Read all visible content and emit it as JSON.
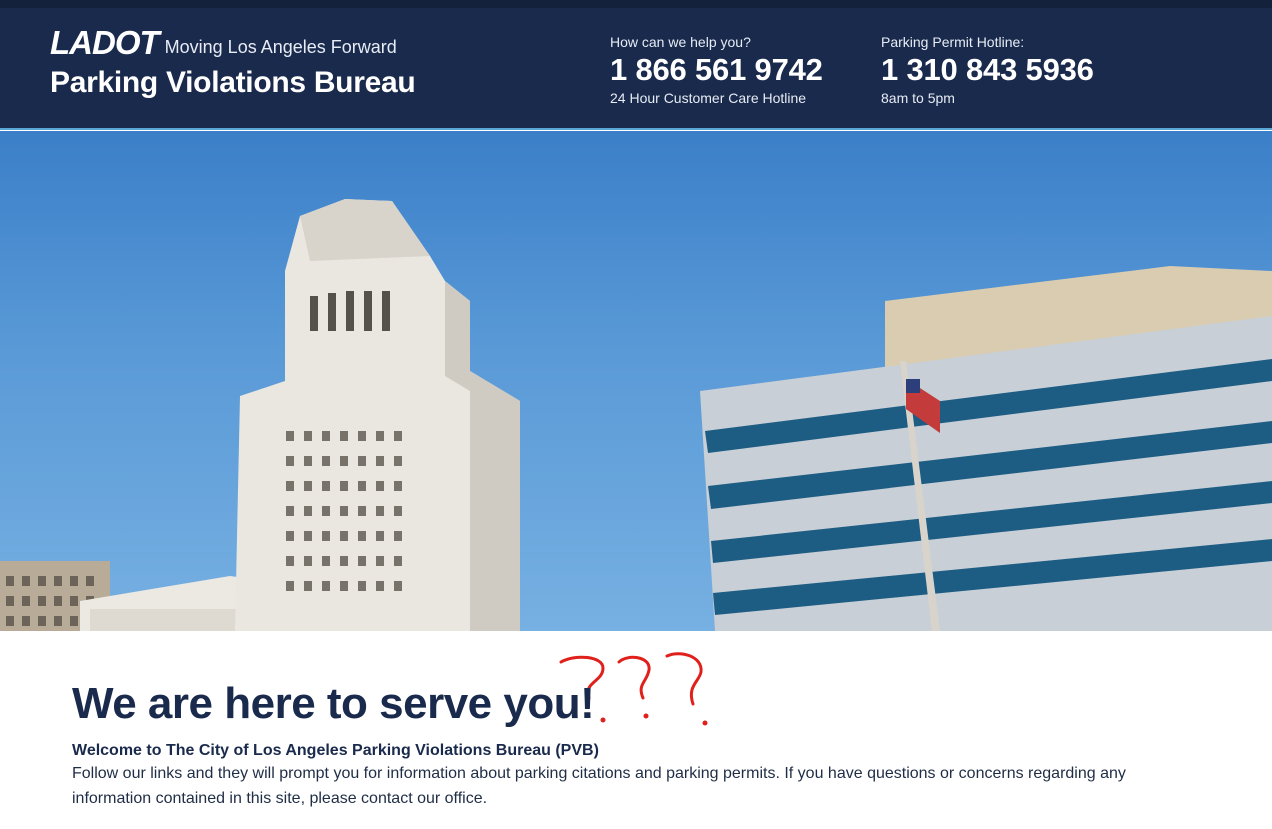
{
  "header": {
    "logo_text": "LADOT",
    "tagline": "Moving Los Angeles Forward",
    "bureau_title": "Parking Violations Bureau",
    "contacts": [
      {
        "question": "How can we help you?",
        "number": "1 866 561 9742",
        "note": "24 Hour Customer Care Hotline"
      },
      {
        "question": "Parking Permit Hotline:",
        "number": "1 310 843 5936",
        "note": "8am to 5pm"
      }
    ]
  },
  "hero": {
    "image": "los-angeles-city-hall-photo"
  },
  "main": {
    "headline": "We are here to serve you!",
    "welcome": "Welcome to The City of Los Angeles Parking Violations Bureau (PVB)",
    "body": "Follow our links and they will prompt you for information about parking citations and parking permits. If you have questions or concerns regarding any information contained in this site, please contact our office."
  },
  "annotation": {
    "text": "???",
    "color": "#e0201a"
  },
  "colors": {
    "header_bg": "#1a2a4c",
    "accent_line": "#5aa7d6",
    "headline": "#1a2a4c"
  }
}
